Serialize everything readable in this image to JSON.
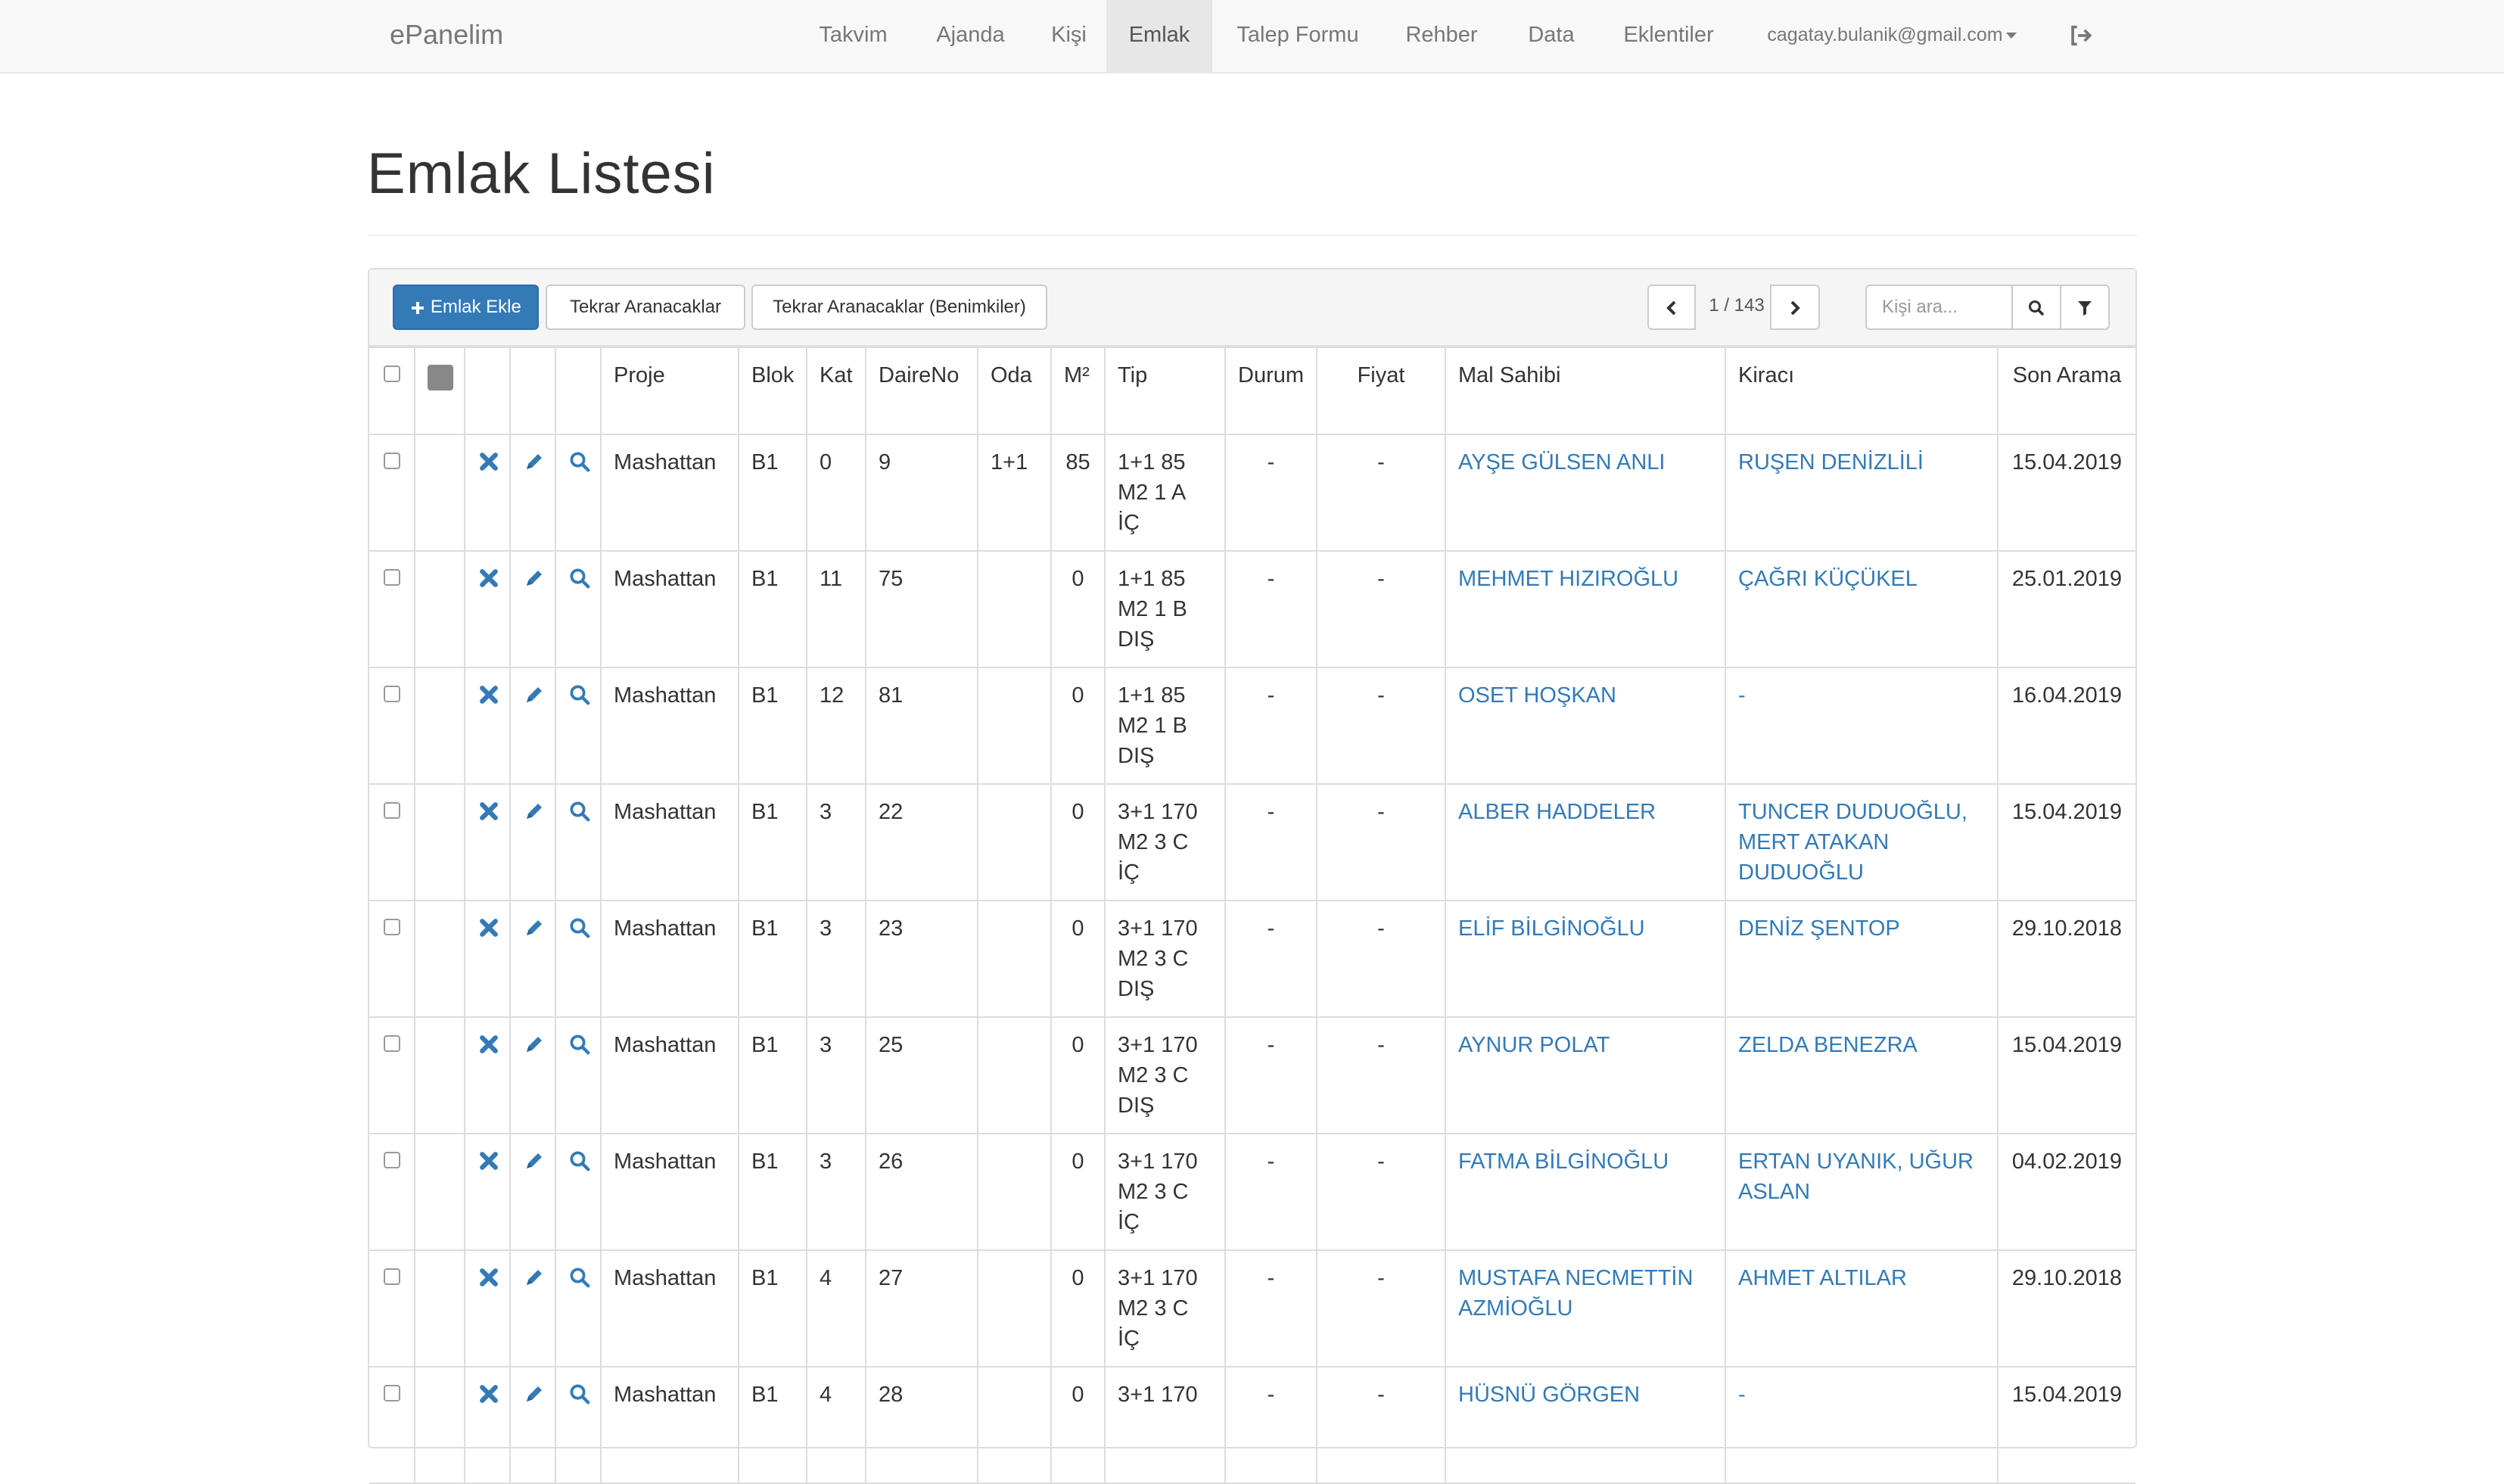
{
  "navbar": {
    "brand": "ePanelim",
    "links": [
      "Takvim",
      "Ajanda",
      "Kişi",
      "Emlak",
      "Talep Formu",
      "Rehber",
      "Data",
      "Eklentiler"
    ],
    "active": "Emlak",
    "user": "cagatay.bulanik@gmail.com"
  },
  "page": {
    "title": "Emlak Listesi"
  },
  "toolbar": {
    "add_label": "Emlak Ekle",
    "btn_recall": "Tekrar Aranacaklar",
    "btn_recall_mine": "Tekrar Aranacaklar (Benimkiler)",
    "pager_text": "1 / 143",
    "search_placeholder": "Kişi ara..."
  },
  "table": {
    "headers": {
      "proje": "Proje",
      "blok": "Blok",
      "kat": "Kat",
      "daire": "DaireNo",
      "oda": "Oda",
      "m2": "M²",
      "tip": "Tip",
      "durum": "Durum",
      "fiyat": "Fiyat",
      "malsahibi": "Mal Sahibi",
      "kiraci": "Kiracı",
      "sonarama": "Son Arama"
    },
    "rows": [
      {
        "proje": "Mashattan",
        "blok": "B1",
        "kat": "0",
        "daire": "9",
        "oda": "1+1",
        "m2": "85",
        "tip": "1+1 85 M2 1 A İÇ",
        "durum": "-",
        "fiyat": "-",
        "malsahibi": "AYŞE GÜLSEN ANLI",
        "kiraci": "RUŞEN DENİZLİLİ",
        "sonarama": "15.04.2019"
      },
      {
        "proje": "Mashattan",
        "blok": "B1",
        "kat": "11",
        "daire": "75",
        "oda": "",
        "m2": "0",
        "tip": "1+1 85 M2 1 B DIŞ",
        "durum": "-",
        "fiyat": "-",
        "malsahibi": "MEHMET HIZIROĞLU",
        "kiraci": "ÇAĞRI KÜÇÜKEL",
        "sonarama": "25.01.2019"
      },
      {
        "proje": "Mashattan",
        "blok": "B1",
        "kat": "12",
        "daire": "81",
        "oda": "",
        "m2": "0",
        "tip": "1+1 85 M2 1 B DIŞ",
        "durum": "-",
        "fiyat": "-",
        "malsahibi": "OSET HOŞKAN",
        "kiraci": "-",
        "sonarama": "16.04.2019"
      },
      {
        "proje": "Mashattan",
        "blok": "B1",
        "kat": "3",
        "daire": "22",
        "oda": "",
        "m2": "0",
        "tip": "3+1 170 M2 3 C İÇ",
        "durum": "-",
        "fiyat": "-",
        "malsahibi": "ALBER HADDELER",
        "kiraci": "TUNCER DUDUOĞLU, MERT ATAKAN DUDUOĞLU",
        "sonarama": "15.04.2019"
      },
      {
        "proje": "Mashattan",
        "blok": "B1",
        "kat": "3",
        "daire": "23",
        "oda": "",
        "m2": "0",
        "tip": "3+1 170 M2 3 C DIŞ",
        "durum": "-",
        "fiyat": "-",
        "malsahibi": "ELİF BİLGİNOĞLU",
        "kiraci": "DENİZ ŞENTOP",
        "sonarama": "29.10.2018"
      },
      {
        "proje": "Mashattan",
        "blok": "B1",
        "kat": "3",
        "daire": "25",
        "oda": "",
        "m2": "0",
        "tip": "3+1 170 M2 3 C DIŞ",
        "durum": "-",
        "fiyat": "-",
        "malsahibi": "AYNUR POLAT",
        "kiraci": "ZELDA BENEZRA",
        "sonarama": "15.04.2019"
      },
      {
        "proje": "Mashattan",
        "blok": "B1",
        "kat": "3",
        "daire": "26",
        "oda": "",
        "m2": "0",
        "tip": "3+1 170 M2 3 C İÇ",
        "durum": "-",
        "fiyat": "-",
        "malsahibi": "FATMA BİLGİNOĞLU",
        "kiraci": "ERTAN UYANIK, UĞUR ASLAN",
        "sonarama": "04.02.2019"
      },
      {
        "proje": "Mashattan",
        "blok": "B1",
        "kat": "4",
        "daire": "27",
        "oda": "",
        "m2": "0",
        "tip": "3+1 170 M2 3 C İÇ",
        "durum": "-",
        "fiyat": "-",
        "malsahibi": "MUSTAFA NECMETTİN AZMİOĞLU",
        "kiraci": "AHMET ALTILAR",
        "sonarama": "29.10.2018"
      },
      {
        "proje": "Mashattan",
        "blok": "B1",
        "kat": "4",
        "daire": "28",
        "oda": "",
        "m2": "0",
        "tip": "3+1 170",
        "durum": "-",
        "fiyat": "-",
        "malsahibi": "HÜSNÜ GÖRGEN",
        "kiraci": "-",
        "sonarama": "15.04.2019"
      }
    ]
  }
}
